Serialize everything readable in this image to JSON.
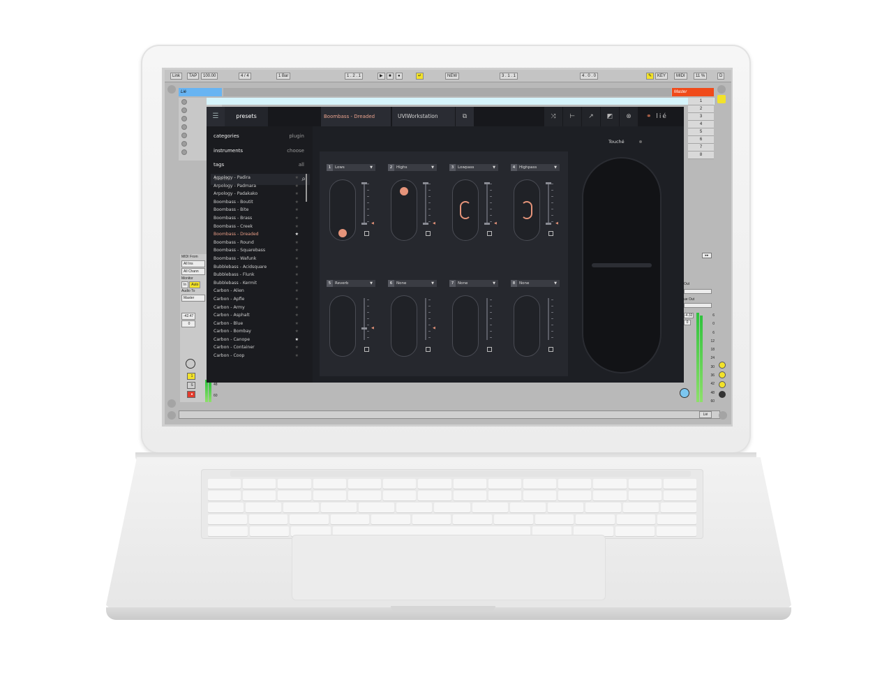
{
  "host": {
    "transport": {
      "link": "Link",
      "tap": "TAP",
      "tempo": "100.00",
      "signature": "4 / 4",
      "quantize": "1 Bar",
      "position": "1 . 2 . 1",
      "new": "NEW",
      "loop_start": "3 . 1 . 1",
      "loop_length": "4 . 0 . 0",
      "key": "KEY",
      "midi": "MIDI",
      "cpu": "11 %",
      "disk": "D"
    },
    "track_name": "Lié",
    "master_name": "Master",
    "scenes": [
      "1",
      "2",
      "3",
      "4",
      "5",
      "6",
      "7",
      "8"
    ],
    "io": {
      "midi_from": "MIDI From",
      "all_ins": "All Ins",
      "all_channels": "All Chann",
      "monitor": "Monitor",
      "in": "In",
      "auto": "Auto",
      "audio_to": "Audio To",
      "master": "Master",
      "vol": "-42.47",
      "pan": "0",
      "track_num": "1",
      "solo": "S",
      "arm": "●",
      "db_48": "48",
      "db_60": "60"
    },
    "master_scale": [
      "6",
      "0",
      "6",
      "12",
      "18",
      "24",
      "30",
      "36",
      "42",
      "48",
      "60"
    ],
    "master_vol": "-4.32",
    "master_pan": "0",
    "out_label": "Out",
    "cue_out": "ue Out",
    "bottom_right": "Lié"
  },
  "plugin": {
    "menu_icon": "hamburger-icon",
    "tab_presets": "presets",
    "preset_name": "Boombass - Dreaded",
    "engine": "UVIWorkstation",
    "brand": "lié",
    "sidebar": {
      "categories": "categories",
      "categories_value": "plugin",
      "instruments": "instruments",
      "instruments_value": "choose",
      "tags": "tags",
      "tags_value": "all",
      "search_placeholder": "Search"
    },
    "presets": [
      {
        "name": "Arpology - Padira",
        "fav": false
      },
      {
        "name": "Arpology - Padmara",
        "fav": false
      },
      {
        "name": "Arpology - Padakako",
        "fav": false
      },
      {
        "name": "Boombass - Boutit",
        "fav": false
      },
      {
        "name": "Boombass - Bite",
        "fav": false
      },
      {
        "name": "Boombass - Brass",
        "fav": false
      },
      {
        "name": "Boombass - Creek",
        "fav": false
      },
      {
        "name": "Boombass - Dreaded",
        "fav": true,
        "selected": true
      },
      {
        "name": "Boombass - Round",
        "fav": false
      },
      {
        "name": "Boombass - Squarebass",
        "fav": false
      },
      {
        "name": "Boombass - Wafunk",
        "fav": false
      },
      {
        "name": "Bubblebass - Acidsquare",
        "fav": false
      },
      {
        "name": "Bubblebass - Flunk",
        "fav": false
      },
      {
        "name": "Bubblebass - Kermit",
        "fav": false
      },
      {
        "name": "Carbon - Alien",
        "fav": false
      },
      {
        "name": "Carbon - Apfle",
        "fav": false
      },
      {
        "name": "Carbon - Army",
        "fav": false
      },
      {
        "name": "Carbon - Asphalt",
        "fav": false
      },
      {
        "name": "Carbon - Blue",
        "fav": false
      },
      {
        "name": "Carbon - Bombay",
        "fav": false
      },
      {
        "name": "Carbon - Canope",
        "fav": true
      },
      {
        "name": "Carbon - Container",
        "fav": false
      },
      {
        "name": "Carbon - Coop",
        "fav": false
      }
    ],
    "slots": [
      {
        "num": "1",
        "label": "Lows"
      },
      {
        "num": "2",
        "label": "Highs"
      },
      {
        "num": "3",
        "label": "Lowpass"
      },
      {
        "num": "4",
        "label": "Highpass"
      },
      {
        "num": "5",
        "label": "Reverb"
      },
      {
        "num": "6",
        "label": "None"
      },
      {
        "num": "7",
        "label": "None"
      },
      {
        "num": "8",
        "label": "None"
      }
    ],
    "touche_label": "Touché",
    "accent": "#e6947a",
    "background": "#1d1f24"
  }
}
